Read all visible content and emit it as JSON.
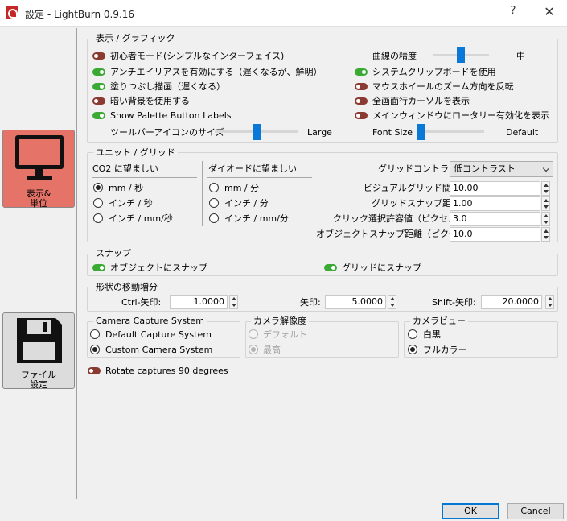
{
  "window": {
    "title": "設定 - LightBurn 0.9.16",
    "help": "?",
    "close": "✕"
  },
  "sidebar": [
    {
      "label": "表示&\n単位",
      "icon": "monitor-icon"
    },
    {
      "label": "ファイル\n設定",
      "icon": "floppy-disk-icon"
    }
  ],
  "display": {
    "title": "表示 / グラフィック",
    "beginner_mode": "初心者モード(シンプルなインターフェイス)",
    "antialias": "アンチエイリアスを有効にする（遅くなるが、鮮明）",
    "fill_draw": "塗りつぶし描画（遅くなる）",
    "dark_bg": "暗い背景を使用する",
    "palette_labels": "Show Palette Button Labels",
    "toolbar_icon_size": "ツールバーアイコンのサイズ",
    "toolbar_icon_value": "Large",
    "curve_precision": "曲線の精度",
    "curve_precision_value": "中",
    "system_clipboard": "システムクリップボードを使用",
    "reverse_wheel": "マウスホイールのズーム方向を反転",
    "fullscreen_cursor": "全画面行カーソルを表示",
    "rotary_main": "メインウィンドウにロータリー有効化を表示",
    "font_size": "Font Size",
    "font_size_value": "Default",
    "toggles": {
      "beginner_mode": false,
      "antialias": true,
      "fill_draw": true,
      "dark_bg": false,
      "palette_labels": true,
      "system_clipboard": true,
      "reverse_wheel": false,
      "fullscreen_cursor": false,
      "rotary_main": false
    },
    "sliders": {
      "curve_precision": 0.5,
      "toolbar_icon_size": 0.5,
      "font_size": 0.0
    }
  },
  "units": {
    "title": "ユニット / グリッド",
    "co2_header": "CO2 に望ましい",
    "co2_options": [
      "mm / 秒",
      "インチ / 秒",
      "インチ / mm/秒"
    ],
    "co2_selected": 0,
    "diode_header": "ダイオードに望ましい",
    "diode_options": [
      "mm / 分",
      "インチ / 分",
      "インチ / mm/分"
    ],
    "diode_selected": -1,
    "grid_contrast_label": "グリッドコントラスト",
    "grid_contrast_value": "低コントラスト",
    "visual_grid_label": "ビジュアルグリッド間隔",
    "visual_grid_value": "10.00",
    "grid_snap_label": "グリッドスナップ距離",
    "grid_snap_value": "1.00",
    "click_tol_label": "クリック選択許容値（ピクセル）",
    "click_tol_value": "3.0",
    "obj_snap_label": "オブジェクトスナップ距離（ピクセル）",
    "obj_snap_value": "10.0"
  },
  "snap": {
    "title": "スナップ",
    "object_snap": "オブジェクトにスナップ",
    "grid_snap": "グリッドにスナップ",
    "toggles": {
      "object_snap": true,
      "grid_snap": true
    }
  },
  "nudge": {
    "title": "形状の移動増分",
    "ctrl_label": "Ctrl-矢印:",
    "ctrl_value": "1.0000",
    "arrow_label": "矢印:",
    "arrow_value": "5.0000",
    "shift_label": "Shift-矢印:",
    "shift_value": "20.0000"
  },
  "camera": {
    "capture_title": "Camera Capture System",
    "capture_options": [
      "Default Capture System",
      "Custom Camera System"
    ],
    "capture_selected": 1,
    "resolution_title": "カメラ解像度",
    "resolution_options": [
      "デフォルト",
      "最高"
    ],
    "resolution_selected": 1,
    "view_title": "カメラビュー",
    "view_options": [
      "白黒",
      "フルカラー"
    ],
    "view_selected": 1,
    "rotate_label": "Rotate captures 90 degrees",
    "rotate_on": false
  },
  "footer": {
    "ok": "OK",
    "cancel": "Cancel"
  }
}
